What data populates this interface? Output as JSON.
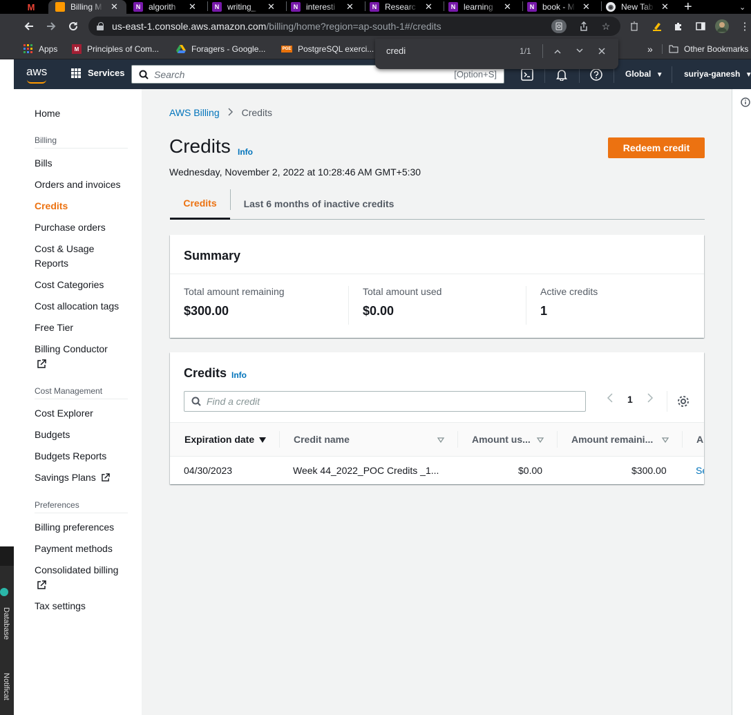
{
  "browser": {
    "tabs": [
      {
        "label": "",
        "favicon": "M",
        "color": "#ea4335",
        "active": false
      },
      {
        "label": "Billing M",
        "favicon": "■",
        "color": "#ff9900",
        "active": true
      },
      {
        "label": "algorith",
        "favicon": "N",
        "color": "#7719aa",
        "active": false
      },
      {
        "label": "writing_",
        "favicon": "N",
        "color": "#7719aa",
        "active": false
      },
      {
        "label": "interesti",
        "favicon": "N",
        "color": "#7719aa",
        "active": false
      },
      {
        "label": "Researc",
        "favicon": "N",
        "color": "#7719aa",
        "active": false
      },
      {
        "label": "learning",
        "favicon": "N",
        "color": "#7719aa",
        "active": false
      },
      {
        "label": "book - M",
        "favicon": "N",
        "color": "#7719aa",
        "active": false
      },
      {
        "label": "New Tab",
        "favicon": "◉",
        "color": "#5f6368",
        "active": false
      }
    ],
    "url_host": "us-east-1.console.aws.amazon.com",
    "url_path": "/billing/home?region=ap-south-1#/credits",
    "bookmarks": [
      {
        "label": "Apps",
        "icon": "apps-grid-icon"
      },
      {
        "label": "Principles of Com...",
        "icon": "mit-ocw-icon"
      },
      {
        "label": "Foragers - Google...",
        "icon": "google-drive-icon"
      },
      {
        "label": "PostgreSQL exerci...",
        "icon": "pge-icon"
      }
    ],
    "bookmarks_overflow": "»",
    "other_bookmarks": "Other Bookmarks",
    "find": {
      "query": "credi",
      "count": "1/1"
    }
  },
  "aws_nav": {
    "logo": "aws",
    "services": "Services",
    "search_placeholder": "Search",
    "search_shortcut": "[Option+S]",
    "region": "Global",
    "user": "suriya-ganesh"
  },
  "sidebar": {
    "home": "Home",
    "sections": [
      {
        "title": "Billing",
        "items": [
          "Bills",
          "Orders and invoices",
          "Credits",
          "Purchase orders",
          "Cost & Usage Reports",
          "Cost Categories",
          "Cost allocation tags",
          "Free Tier",
          "Billing Conductor"
        ]
      },
      {
        "title": "Cost Management",
        "items": [
          "Cost Explorer",
          "Budgets",
          "Budgets Reports",
          "Savings Plans"
        ]
      },
      {
        "title": "Preferences",
        "items": [
          "Billing preferences",
          "Payment methods",
          "Consolidated billing",
          "Tax settings"
        ]
      }
    ]
  },
  "background_app": {
    "database": "Database",
    "notifications": "Notificat"
  },
  "main": {
    "breadcrumb": [
      "AWS Billing",
      "Credits"
    ],
    "title": "Credits",
    "info": "Info",
    "redeem_button": "Redeem credit",
    "timestamp": "Wednesday, November 2, 2022 at 10:28:46 AM GMT+5:30",
    "tabs": [
      "Credits",
      "Last 6 months of inactive credits"
    ],
    "summary": {
      "title": "Summary",
      "items": [
        {
          "label": "Total amount remaining",
          "value": "$300.00"
        },
        {
          "label": "Total amount used",
          "value": "$0.00"
        },
        {
          "label": "Active credits",
          "value": "1"
        }
      ]
    },
    "credits_table": {
      "title": "Credits",
      "info": "Info",
      "search_placeholder": "Find a credit",
      "page": "1",
      "columns": [
        "Expiration date",
        "Credit name",
        "Amount us...",
        "Amount remaini...",
        "Ap"
      ],
      "rows": [
        {
          "expiration": "04/30/2023",
          "name": "Week 44_2022_POC Credits _1...",
          "used": "$0.00",
          "remaining": "$300.00",
          "applicable": "Se"
        }
      ]
    }
  },
  "colors": {
    "accent": "#ec7211",
    "link": "#0073bb",
    "nav_bg": "#232f3e"
  }
}
